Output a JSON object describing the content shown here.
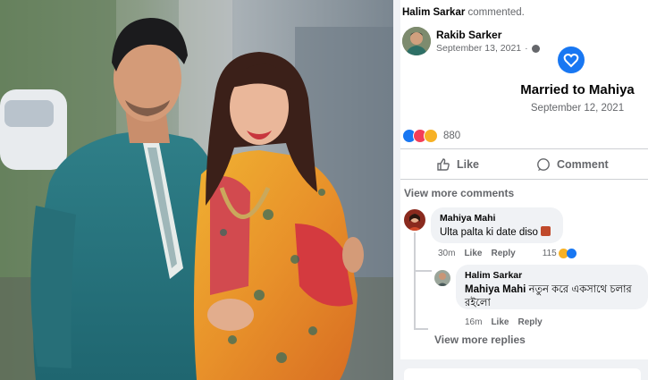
{
  "notification": {
    "commenter": "Halim Sarkar",
    "action": "commented."
  },
  "post": {
    "author": "Rakib Sarker",
    "date": "September 13, 2021",
    "event_title": "Married to Mahiya",
    "event_date": "September 12, 2021",
    "reaction_count": "880"
  },
  "actions": {
    "like": "Like",
    "comment": "Comment"
  },
  "view_more_comments": "View more comments",
  "comments": [
    {
      "author": "Mahiya Mahi",
      "text": "Ulta palta ki date diso",
      "time": "30m",
      "like": "Like",
      "reply": "Reply",
      "reaction_count": "115"
    }
  ],
  "reply": {
    "author": "Halim Sarkar",
    "mention": "Mahiya Mahi",
    "text": "নতুন করে একসাথে চলার রইলো",
    "time": "16m",
    "like": "Like",
    "reply": "Reply"
  },
  "view_more_replies": "View more replies",
  "colors": {
    "facebook_blue": "#1877f2",
    "secondary_text": "#65676b",
    "bubble_bg": "#f0f2f5"
  }
}
